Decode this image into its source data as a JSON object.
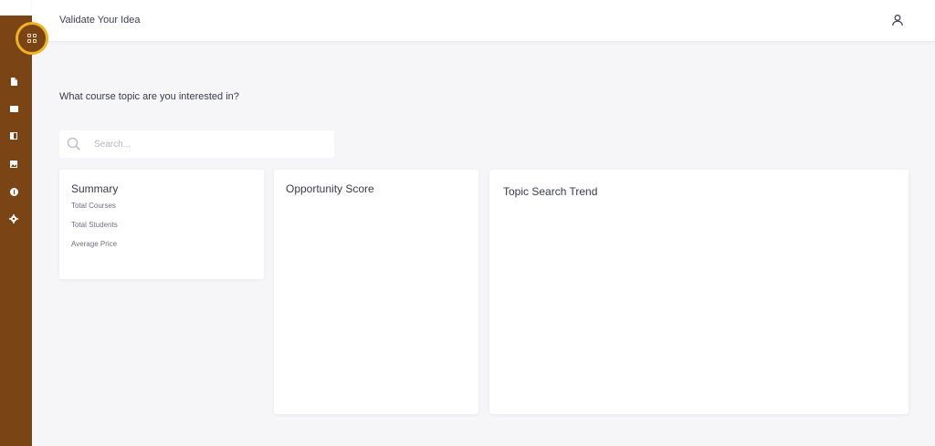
{
  "header": {
    "title": "Validate Your Idea",
    "user_icon": "user-icon"
  },
  "sidebar": {
    "background": "#7a4414",
    "accent": "#f0b323",
    "items": [
      {
        "icon": "document-icon"
      },
      {
        "icon": "square-icon"
      },
      {
        "icon": "half-square-icon"
      },
      {
        "icon": "image-icon"
      },
      {
        "icon": "info-icon"
      },
      {
        "icon": "gear-icon"
      }
    ]
  },
  "main": {
    "question": "What course topic are you interested in?",
    "search": {
      "placeholder": "Search...",
      "value": ""
    },
    "summary": {
      "title": "Summary",
      "stats": [
        "Total Courses",
        "Total Students",
        "Average Price"
      ]
    },
    "opportunity": {
      "title": "Opportunity Score"
    },
    "trend": {
      "title": "Topic Search Trend"
    }
  }
}
